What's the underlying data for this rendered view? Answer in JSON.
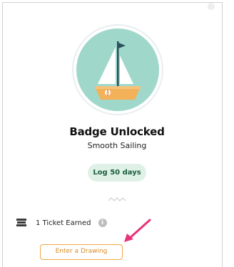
{
  "badge": {
    "icon": "sailboat-icon",
    "title": "Badge Unlocked",
    "name": "Smooth Sailing",
    "requirement": "Log 50 days",
    "background_color": "#9fd8cb"
  },
  "reward": {
    "ticket_icon": "ticket-icon",
    "label": "1 Ticket Earned",
    "info_icon": "info-icon",
    "info_glyph": "i",
    "action_label": "Enter a Drawing",
    "action_color": "#f0a646"
  },
  "annotation": {
    "arrow_color": "#e8337a"
  }
}
